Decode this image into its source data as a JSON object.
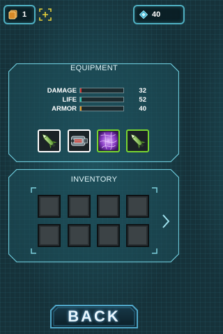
{
  "top_bar": {
    "cards_count": "1",
    "gems_count": "40",
    "accent": "#4fb0c2"
  },
  "equipment": {
    "title": "EQUIPMENT",
    "stats": [
      {
        "label": "DAMAGE",
        "value": "32",
        "fill_fraction": 0.04,
        "color": "#d2322d"
      },
      {
        "label": "LIFE",
        "value": "52",
        "fill_fraction": 0.04,
        "color": "#2bc2b0"
      },
      {
        "label": "ARMOR",
        "value": "40",
        "fill_fraction": 0.04,
        "color": "#e59a22"
      }
    ],
    "slots": [
      {
        "item": "missile",
        "frame": "white"
      },
      {
        "item": "turret",
        "frame": "white"
      },
      {
        "item": "energy-shield",
        "frame": "green"
      },
      {
        "item": "missile",
        "frame": "green"
      }
    ]
  },
  "inventory": {
    "title": "INVENTORY",
    "rows": 2,
    "cols": 4,
    "next_icon": "chevron-right-icon"
  },
  "back_button": {
    "label": "BACK"
  }
}
